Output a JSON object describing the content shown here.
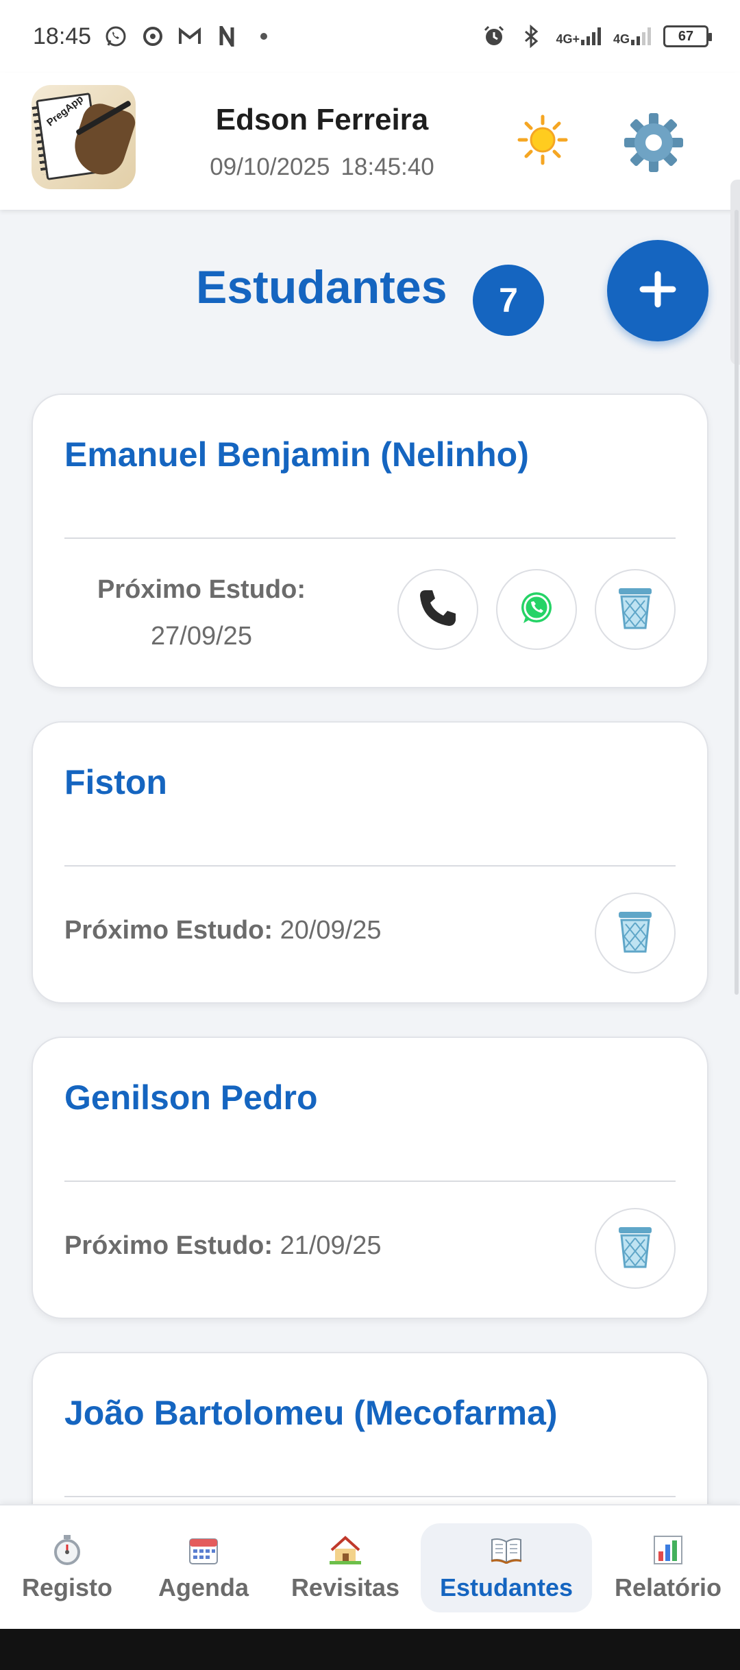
{
  "status_bar": {
    "time": "18:45",
    "network_1": "4G+",
    "network_2": "4G",
    "battery": "67"
  },
  "header": {
    "logo_text": "PregApp",
    "user_name": "Edson Ferreira",
    "date": "09/10/2025",
    "time": "18:45:40",
    "theme_icon": "sun-icon",
    "settings_icon": "gear-icon"
  },
  "page": {
    "title": "Estudantes",
    "count": "7",
    "add_label": "+"
  },
  "students": [
    {
      "name": "Emanuel Benjamin (Nelinho)",
      "next_study_label": "Próximo Estudo:",
      "next_study_date": "27/09/25",
      "actions": [
        "phone",
        "whatsapp",
        "delete"
      ]
    },
    {
      "name": "Fiston",
      "next_study_label": "Próximo Estudo:",
      "next_study_date": "20/09/25",
      "actions": [
        "delete"
      ]
    },
    {
      "name": "Genilson Pedro",
      "next_study_label": "Próximo Estudo:",
      "next_study_date": "21/09/25",
      "actions": [
        "delete"
      ]
    },
    {
      "name": "João Bartolomeu (Mecofarma)"
    }
  ],
  "nav": {
    "items": [
      {
        "label": "Registo",
        "icon": "stopwatch-icon"
      },
      {
        "label": "Agenda",
        "icon": "calendar-icon"
      },
      {
        "label": "Revisitas",
        "icon": "house-icon"
      },
      {
        "label": "Estudantes",
        "icon": "book-icon"
      },
      {
        "label": "Relatório",
        "icon": "bar-chart-icon"
      }
    ],
    "active": "Estudantes"
  },
  "colors": {
    "primary": "#1565c0",
    "background": "#f2f4f7",
    "card": "#ffffff",
    "muted_text": "#6b6b6b"
  }
}
